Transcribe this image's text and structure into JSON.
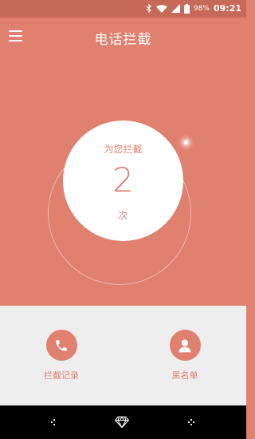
{
  "status_bar": {
    "battery_percent": "98%",
    "time": "09:21",
    "icons": [
      "bluetooth-icon",
      "wifi-icon",
      "signal-icon",
      "battery-icon"
    ]
  },
  "header": {
    "title": "电话拦截",
    "menu_icon": "menu-icon"
  },
  "counter": {
    "label": "为您拦截",
    "count": "2",
    "unit": "次"
  },
  "actions": [
    {
      "label": "拦截记录",
      "icon": "phone-icon"
    },
    {
      "label": "黑名单",
      "icon": "person-icon"
    }
  ],
  "navigation": {
    "buttons": [
      "back-icon",
      "home-icon",
      "recent-apps-icon"
    ]
  },
  "colors": {
    "accent": "#e0806e",
    "status_bar": "#c76959",
    "panel": "#efeeef",
    "nav_bar": "#000000"
  }
}
